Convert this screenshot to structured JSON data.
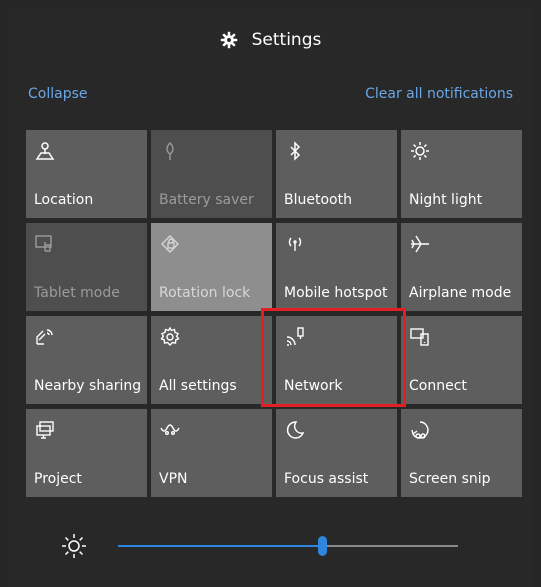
{
  "header": {
    "title": "Settings",
    "icon": "gear-icon"
  },
  "links": {
    "collapse": "Collapse",
    "clear_all": "Clear all notifications"
  },
  "colors": {
    "accent": "#2e86de",
    "highlight": "#e31e24",
    "link": "#6aa7e6"
  },
  "tiles": [
    {
      "label": "Location",
      "icon": "location-icon",
      "state": "on"
    },
    {
      "label": "Battery saver",
      "icon": "battery-saver-icon",
      "state": "disabled"
    },
    {
      "label": "Bluetooth",
      "icon": "bluetooth-icon",
      "state": "on"
    },
    {
      "label": "Night light",
      "icon": "night-light-icon",
      "state": "on"
    },
    {
      "label": "Tablet mode",
      "icon": "tablet-mode-icon",
      "state": "disabled"
    },
    {
      "label": "Rotation lock",
      "icon": "rotation-lock-icon",
      "state": "light"
    },
    {
      "label": "Mobile hotspot",
      "icon": "mobile-hotspot-icon",
      "state": "on"
    },
    {
      "label": "Airplane mode",
      "icon": "airplane-icon",
      "state": "on"
    },
    {
      "label": "Nearby sharing",
      "icon": "nearby-sharing-icon",
      "state": "on"
    },
    {
      "label": "All settings",
      "icon": "gear-icon",
      "state": "on"
    },
    {
      "label": "Network",
      "icon": "network-icon",
      "state": "on"
    },
    {
      "label": "Connect",
      "icon": "connect-icon",
      "state": "on"
    },
    {
      "label": "Project",
      "icon": "project-icon",
      "state": "on"
    },
    {
      "label": "VPN",
      "icon": "vpn-icon",
      "state": "on"
    },
    {
      "label": "Focus assist",
      "icon": "moon-icon",
      "state": "on"
    },
    {
      "label": "Screen snip",
      "icon": "screen-snip-icon",
      "state": "on"
    }
  ],
  "brightness": {
    "icon": "sun-icon",
    "level": 0.6
  }
}
